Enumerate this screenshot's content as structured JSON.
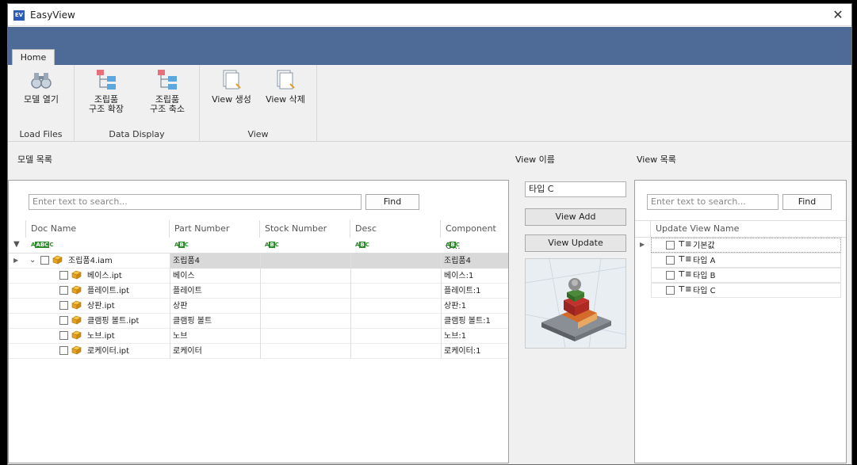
{
  "window": {
    "title": "EasyView",
    "icon_text": "EV"
  },
  "ribbon": {
    "tab": "Home",
    "groups": [
      {
        "label": "Load Files",
        "buttons": [
          {
            "label": "모델 열기"
          }
        ]
      },
      {
        "label": "Data Display",
        "buttons": [
          {
            "label": "조립품\n구조 확장"
          },
          {
            "label": "조립품\n구조 축소"
          }
        ]
      },
      {
        "label": "View",
        "buttons": [
          {
            "label": "View 생성"
          },
          {
            "label": "View 삭제"
          }
        ]
      }
    ]
  },
  "model_list": {
    "title": "모델 목록",
    "search_placeholder": "Enter text to search...",
    "find": "Find",
    "columns": [
      "Doc Name",
      "Part Number",
      "Stock Number",
      "Desc",
      "Component O..."
    ],
    "filter_label": "ABC",
    "rows": [
      {
        "doc": "조립품4.iam",
        "part": "조립품4",
        "stock": "",
        "desc": "",
        "comp": "조립품4"
      },
      {
        "doc": "베이스.ipt",
        "part": "베이스",
        "stock": "",
        "desc": "",
        "comp": "베이스:1"
      },
      {
        "doc": "플레이트.ipt",
        "part": "플레이트",
        "stock": "",
        "desc": "",
        "comp": "플레이트:1"
      },
      {
        "doc": "상판.ipt",
        "part": "상판",
        "stock": "",
        "desc": "",
        "comp": "상판:1"
      },
      {
        "doc": "클램핑 볼트.ipt",
        "part": "클램핑 볼트",
        "stock": "",
        "desc": "",
        "comp": "클램핑 볼트:1"
      },
      {
        "doc": "노브.ipt",
        "part": "노브",
        "stock": "",
        "desc": "",
        "comp": "노브:1"
      },
      {
        "doc": "로케이터.ipt",
        "part": "로케이터",
        "stock": "",
        "desc": "",
        "comp": "로케이터:1"
      }
    ]
  },
  "view_name": {
    "title": "View 이름",
    "value": "타입 C",
    "add": "View Add",
    "update": "View Update"
  },
  "view_list": {
    "title": "View 목록",
    "search_placeholder": "Enter text to search...",
    "find": "Find",
    "column": "Update View Name",
    "items": [
      "기본값",
      "타입 A",
      "타입 B",
      "타입 C"
    ]
  }
}
